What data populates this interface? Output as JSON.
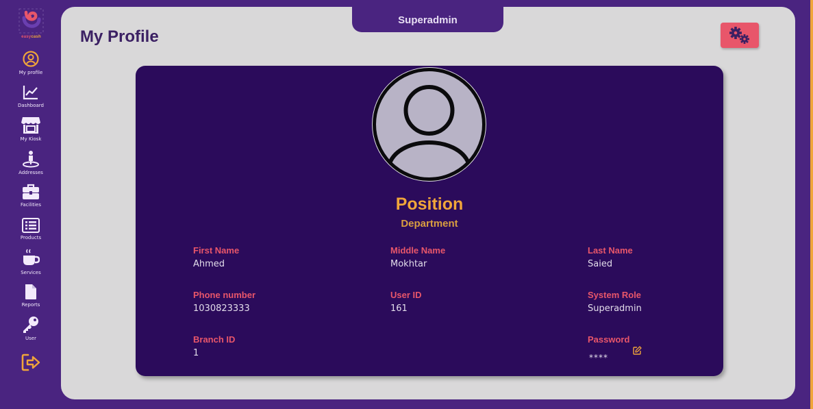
{
  "sidebar": {
    "logo": {
      "text_easy": "easy",
      "text_cash": "cash",
      "icon": "easycash-logo"
    },
    "items": [
      {
        "label": "My profile",
        "icon": "user-circle-icon"
      },
      {
        "label": "Dashboard",
        "icon": "line-chart-icon"
      },
      {
        "label": "My Kiosk",
        "icon": "store-icon"
      },
      {
        "label": "Addresses",
        "icon": "location-person-icon"
      },
      {
        "label": "Facilities",
        "icon": "briefcase-icon"
      },
      {
        "label": "Products",
        "icon": "list-icon"
      },
      {
        "label": "Services",
        "icon": "coffee-cup-icon"
      },
      {
        "label": "Reports",
        "icon": "file-icon"
      },
      {
        "label": "User",
        "icon": "key-icon"
      }
    ],
    "logout_icon": "logout-icon"
  },
  "header": {
    "role_tab": "Superadmin",
    "title": "My Profile",
    "settings_icon": "gears-icon"
  },
  "profile": {
    "position": "Position",
    "department": "Department",
    "fields": {
      "first_name": {
        "label": "First Name",
        "value": "Ahmed"
      },
      "middle_name": {
        "label": "Middle Name",
        "value": "Mokhtar"
      },
      "last_name": {
        "label": "Last Name",
        "value": "Saied"
      },
      "phone": {
        "label": "Phone number",
        "value": "1030823333"
      },
      "user_id": {
        "label": "User ID",
        "value": "161"
      },
      "system_role": {
        "label": "System Role",
        "value": "Superadmin"
      },
      "branch_id": {
        "label": "Branch ID",
        "value": "1"
      },
      "password": {
        "label": "Password",
        "value": "****"
      }
    }
  },
  "colors": {
    "background": "#4a2480",
    "card": "#2b0b5b",
    "accent_orange": "#f0a53a",
    "accent_pink": "#e8566a",
    "panel": "#d9d8d9"
  }
}
